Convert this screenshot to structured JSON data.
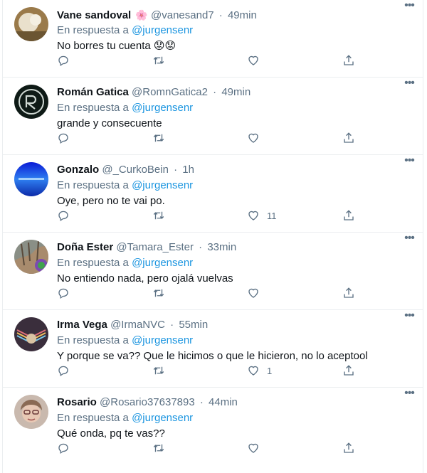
{
  "reply_prefix": "En respuesta a",
  "tweets": [
    {
      "name": "Vane sandoval",
      "name_emoji": "🌸",
      "handle": "@vanesand7",
      "time": "49min",
      "reply_to": "@jurgensenr",
      "text": "No borres tu cuenta",
      "text_emoji": "😟😟",
      "likes": ""
    },
    {
      "name": "Román Gatica",
      "handle": "@RomnGatica2",
      "time": "49min",
      "reply_to": "@jurgensenr",
      "text": "grande y consecuente",
      "likes": ""
    },
    {
      "name": "Gonzalo",
      "handle": "@_CurkoBein",
      "time": "1h",
      "reply_to": "@jurgensenr",
      "text": "Oye, pero no te vai po.",
      "likes": "11"
    },
    {
      "name": "Doña Ester",
      "handle": "@Tamara_Ester",
      "time": "33min",
      "reply_to": "@jurgensenr",
      "text": "No entiendo nada, pero ojalá vuelvas",
      "likes": ""
    },
    {
      "name": "Irma Vega",
      "handle": "@IrmaNVC",
      "time": "55min",
      "reply_to": "@jurgensenr",
      "text": "Y porque se va?? Que le hicimos o que le hicieron, no lo aceptool",
      "likes": "1"
    },
    {
      "name": "Rosario",
      "handle": "@Rosario37637893",
      "time": "44min",
      "reply_to": "@jurgensenr",
      "text": "Qué onda, pq te vas??",
      "likes": ""
    }
  ],
  "separator": "·",
  "more_label": "•••",
  "colors": {
    "secondary_text": "#5b7083",
    "link": "#1b95e0",
    "border": "#ebeef0"
  }
}
